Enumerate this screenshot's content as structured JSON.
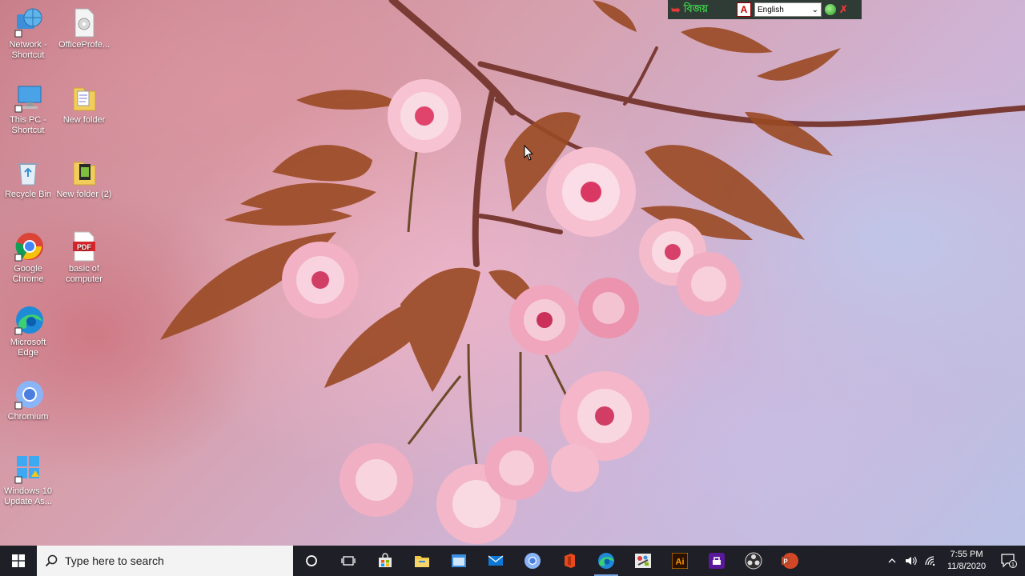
{
  "desktop": {
    "icons": [
      {
        "label": "Network - Shortcut",
        "icon": "network-icon"
      },
      {
        "label": "OfficeProfe...",
        "icon": "disc-file-icon"
      },
      {
        "label": "This PC - Shortcut",
        "icon": "computer-icon"
      },
      {
        "label": "New folder",
        "icon": "folder-icon"
      },
      {
        "label": "Recycle Bin",
        "icon": "recycle-bin-icon"
      },
      {
        "label": "New folder (2)",
        "icon": "folder-icon"
      },
      {
        "label": "Google Chrome",
        "icon": "chrome-icon"
      },
      {
        "label": "basic of computer",
        "icon": "pdf-icon"
      },
      {
        "label": "Microsoft Edge",
        "icon": "edge-icon"
      },
      {
        "label": "Chromium",
        "icon": "chromium-icon"
      },
      {
        "label": "Windows 10 Update As...",
        "icon": "windows-update-icon"
      }
    ],
    "pdf_badge": "PDF"
  },
  "language_bar": {
    "brand": "বিজয়",
    "pdf_letter": "A",
    "selected_language": "English"
  },
  "taskbar": {
    "search_placeholder": "Type here to search",
    "apps": [
      {
        "name": "cortana-icon",
        "active": false
      },
      {
        "name": "task-view-icon",
        "active": false
      },
      {
        "name": "store-icon",
        "active": false
      },
      {
        "name": "file-explorer-icon",
        "active": false
      },
      {
        "name": "window-app-icon",
        "active": false
      },
      {
        "name": "mail-icon",
        "active": false
      },
      {
        "name": "chromium-icon",
        "active": false
      },
      {
        "name": "office-icon",
        "active": false
      },
      {
        "name": "edge-icon",
        "active": true
      },
      {
        "name": "paint-icon",
        "active": false
      },
      {
        "name": "illustrator-icon",
        "active": false
      },
      {
        "name": "purple-app-icon",
        "active": false
      },
      {
        "name": "obs-icon",
        "active": false
      },
      {
        "name": "powerpoint-icon",
        "active": false
      }
    ],
    "illustrator_label": "Ai",
    "clock_time": "7:55 PM",
    "clock_date": "11/8/2020",
    "notification_count": "1"
  },
  "colors": {
    "taskbar_bg": "#1f1f27",
    "active_indicator": "#7aa7e6",
    "brand_red": "#e63a3a",
    "brand_green": "#3ecf4a"
  }
}
